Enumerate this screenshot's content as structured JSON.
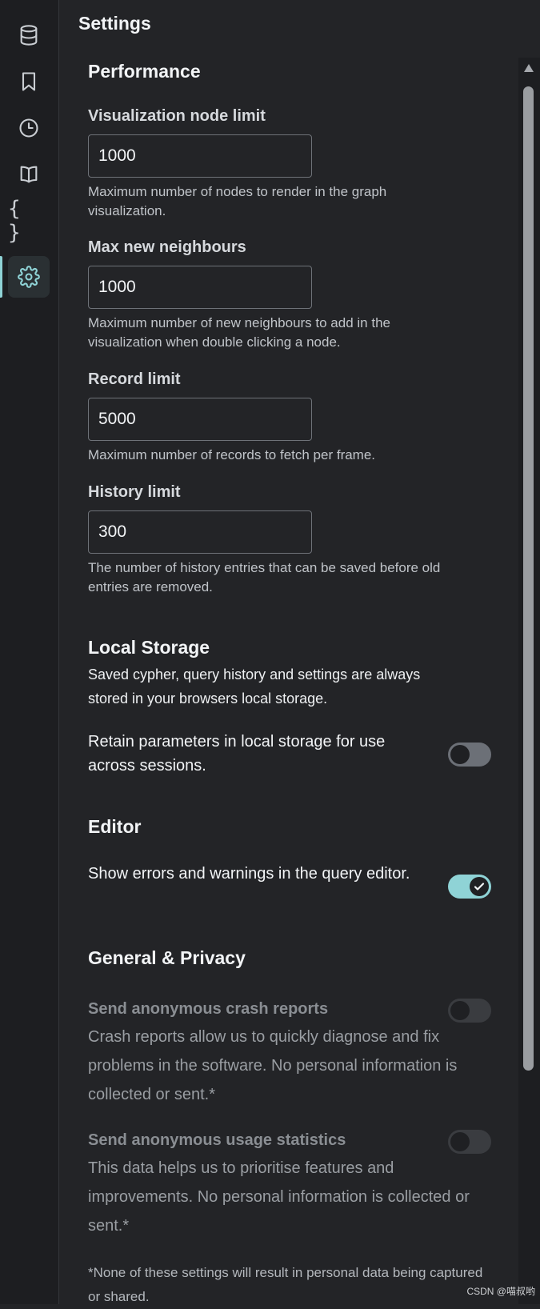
{
  "sidebar": {
    "items": [
      {
        "icon": "database-icon"
      },
      {
        "icon": "bookmark-icon"
      },
      {
        "icon": "history-icon"
      },
      {
        "icon": "book-icon"
      },
      {
        "icon": "braces-icon",
        "glyph": "{ }"
      },
      {
        "icon": "gear-icon",
        "active": true
      }
    ]
  },
  "drawer": {
    "title": "Settings"
  },
  "performance": {
    "title": "Performance",
    "node_limit": {
      "label": "Visualization node limit",
      "value": "1000",
      "help": "Maximum number of nodes to render in the graph visualization."
    },
    "max_neighbours": {
      "label": "Max new neighbours",
      "value": "1000",
      "help": "Maximum number of new neighbours to add in the visualization when double clicking a node."
    },
    "record_limit": {
      "label": "Record limit",
      "value": "5000",
      "help": "Maximum number of records to fetch per frame."
    },
    "history_limit": {
      "label": "History limit",
      "value": "300",
      "help": "The number of history entries that can be saved before old entries are removed."
    }
  },
  "local_storage": {
    "title": "Local Storage",
    "description": "Saved cypher, query history and settings are always stored in your browsers local storage.",
    "retain_params": {
      "label": "Retain parameters in local storage for use across sessions.",
      "enabled": false
    }
  },
  "editor": {
    "title": "Editor",
    "show_errors": {
      "label": "Show errors and warnings in the query editor.",
      "enabled": true
    }
  },
  "general_privacy": {
    "title": "General & Privacy",
    "crash_reports": {
      "label": "Send anonymous crash reports",
      "description": "Crash reports allow us to quickly diagnose and fix problems in the software. No personal information is collected or sent.*",
      "enabled": false
    },
    "usage_stats": {
      "label": "Send anonymous usage statistics",
      "description": "This data helps us to prioritise features and improvements. No personal information is collected or sent.*",
      "enabled": false
    },
    "footnote": "*None of these settings will result in personal data being captured or shared."
  },
  "watermark": "CSDN @喵叔哟",
  "colors": {
    "accent": "#8fd3d6",
    "background": "#232427",
    "rail": "#1d1e21"
  }
}
